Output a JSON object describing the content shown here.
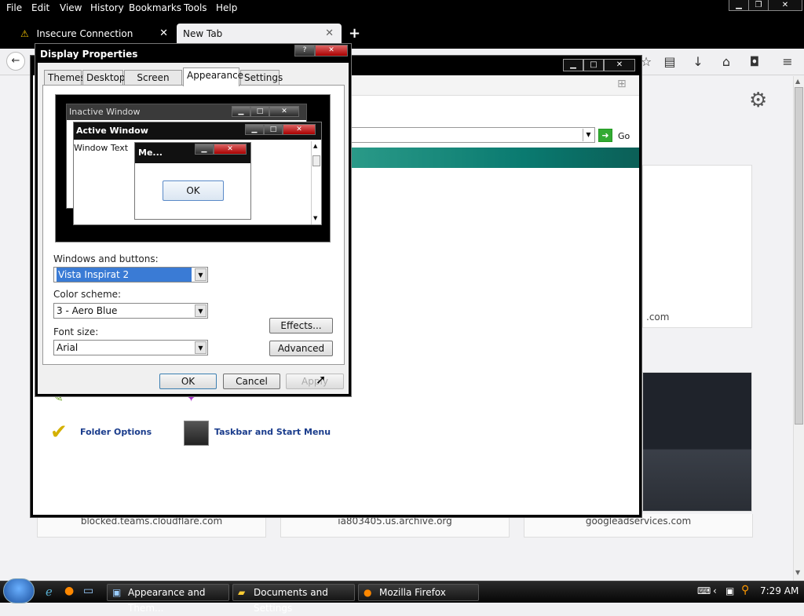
{
  "menubar": {
    "items": [
      "File",
      "Edit",
      "View",
      "History",
      "Bookmarks",
      "Tools",
      "Help"
    ]
  },
  "tabs": [
    {
      "label": "Insecure Connection",
      "warning": true
    },
    {
      "label": "New Tab",
      "active": true
    }
  ],
  "colors": {
    "dialog_title_bg": "#000000",
    "selection_blue": "#3a7bd5",
    "teal_band": "#0a7a70",
    "close_red": "#b81414"
  },
  "tiles": [
    {
      "label": "blocked.teams.cloudflare.com"
    },
    {
      "label": "ia803405.us.archive.org"
    },
    {
      "label": "googleadservices.com"
    }
  ],
  "partial_tile_suffix": ".com",
  "address": {
    "go_label": "Go"
  },
  "control_panel": {
    "items": [
      {
        "label": "Folder Options",
        "icon": "folder-options-icon"
      },
      {
        "label": "Taskbar and Start Menu",
        "icon": "taskbar-icon"
      }
    ]
  },
  "dialog": {
    "title": "Display Properties",
    "tabs": [
      "Themes",
      "Desktop",
      "Screen Saver",
      "Appearance",
      "Settings"
    ],
    "active_tab": "Appearance",
    "preview": {
      "inactive_title": "Inactive Window",
      "active_title": "Active Window",
      "window_text": "Window Text",
      "msgbox_title": "Me...",
      "msgbox_ok": "OK"
    },
    "windows_buttons_label": "Windows and buttons:",
    "windows_buttons_value": "Vista Inspirat 2",
    "color_scheme_label": "Color scheme:",
    "color_scheme_value": "3 - Aero Blue",
    "font_size_label": "Font size:",
    "font_size_value": "Arial",
    "effects_label": "Effects...",
    "advanced_label": "Advanced",
    "ok_label": "OK",
    "cancel_label": "Cancel",
    "apply_label": "Apply"
  },
  "taskbar": {
    "items": [
      {
        "label": "Appearance and Them..."
      },
      {
        "label": "Documents and Settings"
      },
      {
        "label": "Mozilla Firefox"
      }
    ],
    "clock": "7:29 AM"
  }
}
